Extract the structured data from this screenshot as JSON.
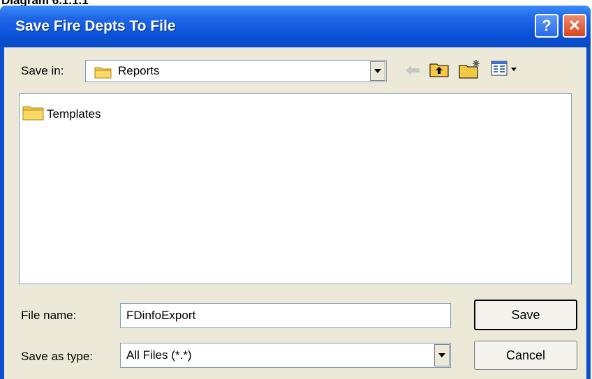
{
  "caption": "Diagram 6.1.1.1",
  "window": {
    "title": "Save Fire Depts To File",
    "help_glyph": "?",
    "close_glyph": "✕"
  },
  "toolbar": {
    "save_in_label": "Save in:",
    "folder": "Reports",
    "icons": [
      "back-arrow-icon",
      "up-one-level-icon",
      "new-folder-icon",
      "view-menu-icon"
    ]
  },
  "files": [
    {
      "name": "Templates",
      "icon": "folder-icon"
    }
  ],
  "filename": {
    "label": "File name:",
    "value": "FDinfoExport"
  },
  "filetype": {
    "label": "Save as type:",
    "value": "All Files (*.*)"
  },
  "buttons": {
    "save": "Save",
    "cancel": "Cancel"
  },
  "colors": {
    "titlebar": "#0a52d8",
    "dialog_bg": "#ece9d8",
    "close": "#d8441c"
  }
}
